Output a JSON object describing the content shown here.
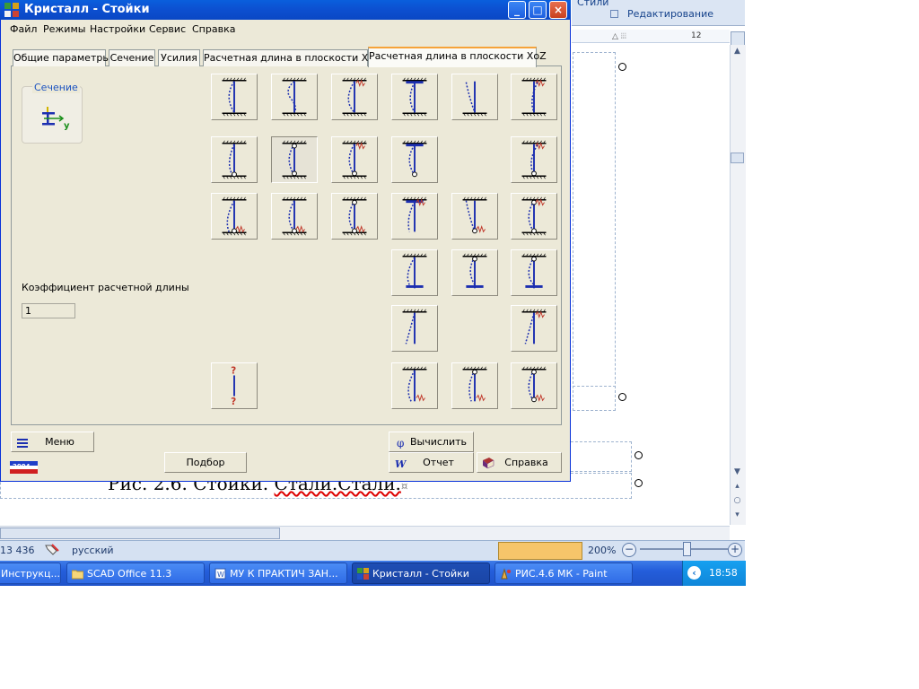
{
  "word": {
    "ribbon_styles": "Стили",
    "ribbon_edit": "Редактирование",
    "ruler_number": "12",
    "caption_main": "Рис. 2.6. Стойки. ",
    "caption_misspelled": "Стали.Стали.",
    "caption_mark": "¤",
    "status_words": "13 436",
    "status_language": "русский",
    "zoom_level": "200%",
    "zoom_minus": "−",
    "zoom_plus": "+"
  },
  "taskbar": {
    "items": [
      {
        "label": "Инструкц..."
      },
      {
        "label": "SCAD Office 11.3"
      },
      {
        "label": "МУ К ПРАКТИЧ ЗАН..."
      },
      {
        "label": "Кристалл - Стойки"
      },
      {
        "label": "РИС.4.6 МК - Paint"
      }
    ],
    "clock": "18:58"
  },
  "dialog": {
    "title": "Кристалл - Стойки",
    "menu": [
      "Файл",
      "Режимы",
      "Настройки",
      "Сервис",
      "Справка"
    ],
    "tabs": [
      "Общие параметры",
      "Сечение",
      "Усилия",
      "Расчетная длина в плоскости XoY",
      "Расчетная длина в плоскости XoZ"
    ],
    "active_tab": "Расчетная длина в плоскости XoZ",
    "section_group_label": "Сечение",
    "section_axis_label": "y",
    "coef_label": "Коэффициент расчетной длины",
    "coef_value": "1",
    "unknown_scheme_mark": "?",
    "buttons": {
      "menu": "Меню",
      "select": "Подбор",
      "calculate": "Вычислить",
      "report": "Отчет",
      "help": "Справка"
    },
    "logo_text": "2004",
    "window_buttons": {
      "minimize": "_",
      "maximize": "□",
      "close": "×"
    }
  },
  "colors": {
    "titlebar": "#0a53d5",
    "dialog_bg": "#ece9d8",
    "active_tab_accent": "#f6a33a",
    "scheme_line": "#1c2fb0",
    "scheme_spring": "#c0392b",
    "taskbar": "#245edb"
  }
}
